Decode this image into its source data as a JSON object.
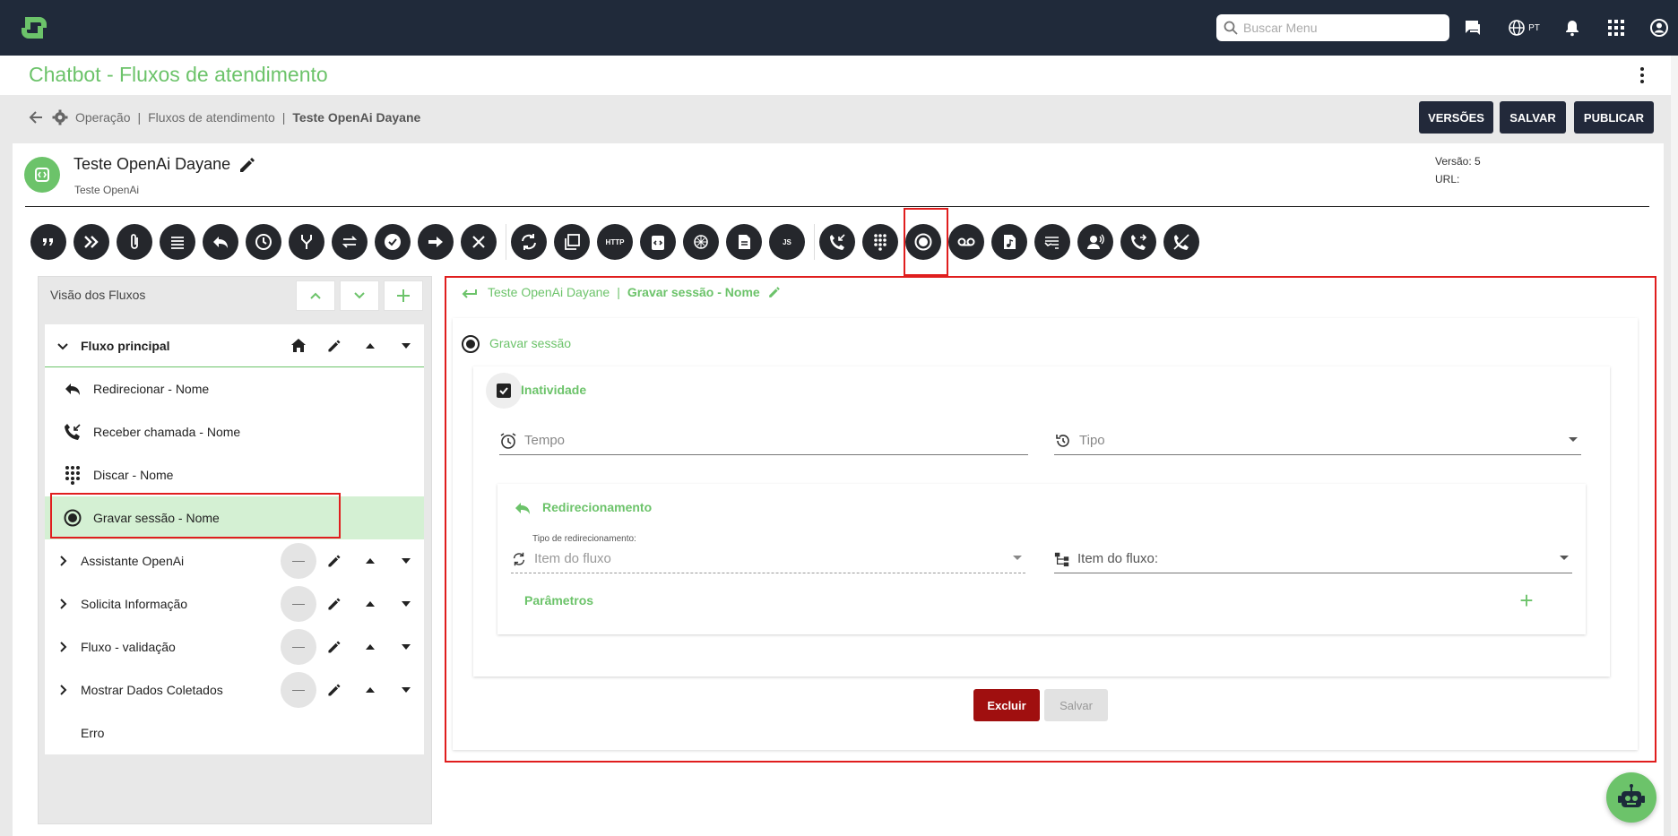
{
  "topbar": {
    "search_placeholder": "Buscar Menu",
    "language_code": "PT"
  },
  "page": {
    "title": "Chatbot - Fluxos de atendimento"
  },
  "breadcrumb": {
    "items": [
      "Operação",
      "Fluxos de atendimento"
    ],
    "current": "Teste OpenAi Dayane",
    "separator": "|"
  },
  "actions": {
    "versions": "VERSÕES",
    "save": "SALVAR",
    "publish": "PUBLICAR"
  },
  "flow": {
    "name": "Teste OpenAi Dayane",
    "subtitle": "Teste OpenAi",
    "version_label": "Versão: 5",
    "url_label": "URL:"
  },
  "toolbar": {
    "icons": [
      "quote-icon",
      "double-chevron-icon",
      "attachment-icon",
      "menu-lines-icon",
      "reply-icon",
      "clock-icon",
      "fork-icon",
      "swap-icon",
      "check-icon",
      "arrow-right-icon",
      "close-icon",
      "sync-icon",
      "copy-icon",
      "http-icon",
      "code-clipboard-icon",
      "openai-icon",
      "document-icon",
      "js-icon",
      "incoming-call-icon",
      "dialpad-icon",
      "record-icon",
      "voicemail-icon",
      "audio-file-icon",
      "phone-keypad-icon",
      "person-voice-icon",
      "call-forward-icon",
      "call-end-icon"
    ],
    "http_text": "HTTP",
    "js_text": "JS"
  },
  "left_panel": {
    "title": "Visão dos Fluxos",
    "main_flow": "Fluxo principal",
    "children": [
      {
        "label": "Redirecionar - Nome",
        "icon": "reply-icon"
      },
      {
        "label": "Receber chamada - Nome",
        "icon": "incoming-call-icon"
      },
      {
        "label": "Discar - Nome",
        "icon": "dialpad-icon"
      },
      {
        "label": "Gravar sessão - Nome",
        "icon": "record-icon"
      }
    ],
    "flows": [
      "Assistante OpenAi",
      "Solicita Informação",
      "Fluxo - validação",
      "Mostrar Dados Coletados"
    ],
    "error_item": "Erro"
  },
  "detail": {
    "crumb_flow": "Teste OpenAi Dayane",
    "crumb_sep": "|",
    "crumb_node": "Gravar sessão - Nome",
    "section_title": "Gravar sessão",
    "inactivity_label": "Inatividade",
    "inactivity_checked": true,
    "tempo_placeholder": "Tempo",
    "tipo_placeholder": "Tipo",
    "redirect_title": "Redirecionamento",
    "redirect_type_label": "Tipo de redirecionamento:",
    "redirect_type_value": "Item do fluxo",
    "flow_item_label": "Item do fluxo:",
    "params_label": "Parâmetros",
    "delete_button": "Excluir",
    "save_button": "Salvar"
  },
  "colors": {
    "accent": "#6cc36a",
    "topbar": "#202a3a",
    "danger": "#a00f0f",
    "highlight": "#e01e1e"
  }
}
